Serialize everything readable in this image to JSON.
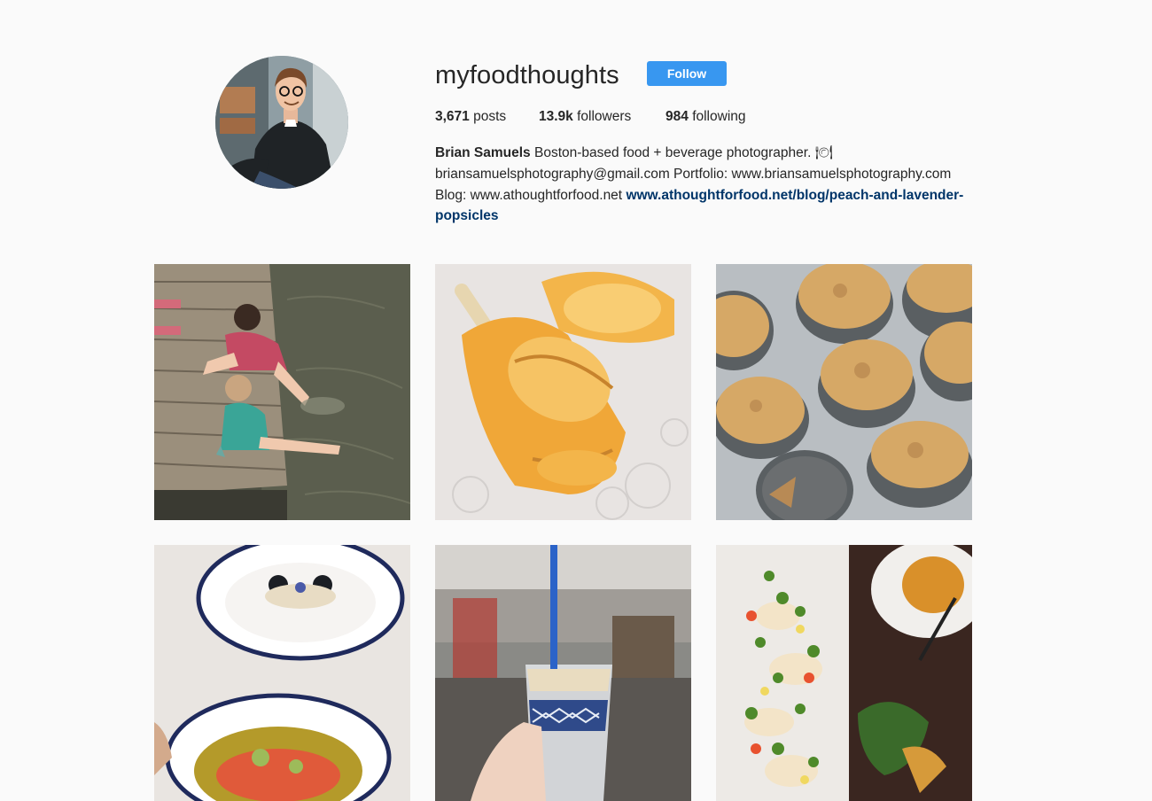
{
  "profile": {
    "username": "myfoodthoughts",
    "follow_label": "Follow",
    "stats": {
      "posts_count": "3,671",
      "posts_label": "posts",
      "followers_count": "13.9k",
      "followers_label": "followers",
      "following_count": "984",
      "following_label": "following"
    },
    "bio": {
      "name": "Brian Samuels",
      "line1": "Boston-based food + beverage photographer. 🍽",
      "line2": "briansamuelsphotography@gmail.com Portfolio: www.briansamuelsphotography.com",
      "line3": "Blog: www.athoughtforfood.net",
      "link": "www.athoughtforfood.net/blog/peach-and-lavender-popsicles"
    }
  },
  "posts": [
    {
      "subject": "kids-on-dock"
    },
    {
      "subject": "peach-popsicles"
    },
    {
      "subject": "muffins"
    },
    {
      "subject": "mezzana-crudo"
    },
    {
      "subject": "iced-drink"
    },
    {
      "subject": "plated-crudo"
    }
  ],
  "colors": {
    "accent": "#3897f0",
    "link": "#003569",
    "background": "#fafafa"
  }
}
